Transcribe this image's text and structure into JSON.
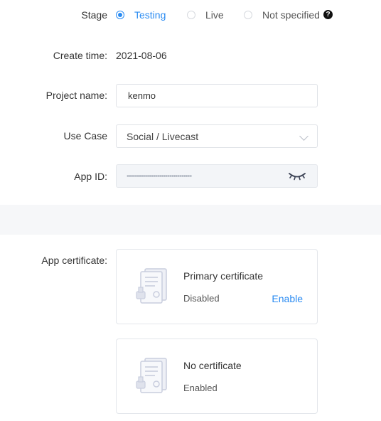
{
  "stage": {
    "label": "Stage",
    "options": [
      "Testing",
      "Live",
      "Not specified"
    ],
    "selected": "Testing",
    "help_icon": "question-circle-icon"
  },
  "create_time": {
    "label": "Create time:",
    "value": "2021-08-06"
  },
  "project_name": {
    "label": "Project name:",
    "value": "kenmo"
  },
  "use_case": {
    "label": "Use Case",
    "value": "Social / Livecast",
    "icon": "chevron-down-icon"
  },
  "app_id": {
    "label": "App ID:",
    "masked_value": "••••••••••••••••••••••••••••••••",
    "icon": "eye-closed-icon"
  },
  "app_certificate": {
    "label": "App certificate:",
    "cards": [
      {
        "title": "Primary certificate",
        "status": "Disabled",
        "action": "Enable",
        "icon": "certificate-icon"
      },
      {
        "title": "No certificate",
        "status": "Enabled",
        "icon": "certificate-icon"
      }
    ]
  },
  "colors": {
    "accent": "#2a8bf2",
    "band": "#f6f7f9",
    "border": "#dfe2e7"
  }
}
